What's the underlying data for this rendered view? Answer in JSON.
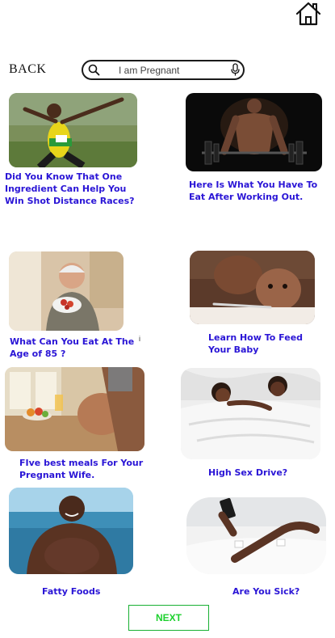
{
  "header": {
    "home_icon": "home-icon",
    "back_label": "BACK"
  },
  "search": {
    "value": "I am Pregnant",
    "search_icon": "search-icon",
    "mic_icon": "microphone-icon"
  },
  "articles": [
    {
      "title": "Did You Know That One Ingredient Can Help You Win Shot Distance Races?",
      "image": "sprinter-celebrating"
    },
    {
      "title": "Here Is What You Have To Eat After Working Out.",
      "image": "bodybuilder-barbell"
    },
    {
      "title": "What Can You Eat At The Age of 85 ?",
      "image": "elderly-man-eating-fruit"
    },
    {
      "title": "Learn How To Feed Your Baby",
      "image": "mother-feeding-baby"
    },
    {
      "title": "FIve best meals For Your Pregnant Wife.",
      "image": "pregnant-woman-with-fruit"
    },
    {
      "title": "High Sex Drive?",
      "image": "couple-in-bed"
    },
    {
      "title": "Fatty Foods",
      "image": "overweight-man-at-beach"
    },
    {
      "title": "Are You Sick?",
      "image": "hospital-patient-with-phone"
    }
  ],
  "stray_mark": "i",
  "footer": {
    "next_label": "NEXT"
  },
  "colors": {
    "title_text": "#2a15d6",
    "next_text": "#1dd12e",
    "next_border": "#19b033"
  }
}
